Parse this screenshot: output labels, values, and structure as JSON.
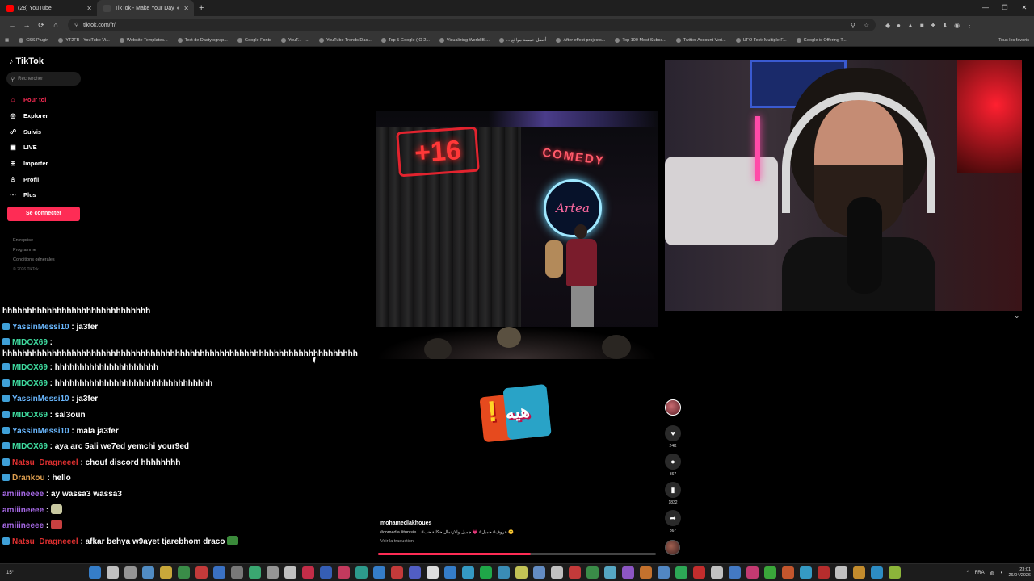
{
  "browser": {
    "tabs": [
      {
        "label": "(28) YouTube",
        "color": "#ff0000"
      },
      {
        "label": "TikTok - Make Your Day",
        "color": "#111111"
      }
    ],
    "url": "tiktok.com/fr/",
    "bookmarks": [
      "CSS Plugin",
      "YT2FB - YouTube Vi...",
      "Website Templates...",
      "Test de Dactylograp...",
      "Google Fonts",
      "YouT... - ...",
      "YouTube Trends Das...",
      "Top 5 Google (IO 2...",
      "Visualizing World Bi...",
      "... أفضل خمسة مواقع",
      "After effect projects...",
      "Top 100 Most Subsc...",
      "Twitter Account Veri...",
      "UFO Test: Multiple F...",
      "Google is Offering T..."
    ],
    "bookmarks_all": "Tous les favoris"
  },
  "tiktok": {
    "logo": "TikTok",
    "search_placeholder": "Rechercher",
    "nav": [
      {
        "label": "Pour toi",
        "icon": "home-icon"
      },
      {
        "label": "Explorer",
        "icon": "compass-icon"
      },
      {
        "label": "Suivis",
        "icon": "following-icon"
      },
      {
        "label": "LIVE",
        "icon": "live-icon"
      },
      {
        "label": "Importer",
        "icon": "upload-icon"
      },
      {
        "label": "Profil",
        "icon": "profile-icon"
      },
      {
        "label": "Plus",
        "icon": "more-icon"
      }
    ],
    "login": "Se connecter",
    "footer": [
      "Entreprise",
      "Programme",
      "Conditions générales"
    ],
    "copyright": "© 2026 TikTok",
    "video": {
      "sign": "+16",
      "neon_text": "COMEDY",
      "neon_name": "Artea",
      "sticker": "هيه"
    },
    "caption_user": "mohamedlakhoues",
    "caption_text": "#comedia #tunisie... #عروف# جميل# 💗 جميل والازنمال حكاية حب 😊",
    "caption_translate": "Voir la traduction",
    "progress": 0.55,
    "counts": {
      "likes": "24K",
      "comments": "367",
      "saves": "1832",
      "shares": "867"
    }
  },
  "chat": [
    {
      "user": "",
      "text": "hhhhhhhhhhhhhhhhhhhhhhhhhhhhhh",
      "color": "#ffffff",
      "badge": false
    },
    {
      "user": "YassinMessi10",
      "text": " : ja3fer",
      "color": "#6ab8ff",
      "badge": true
    },
    {
      "user": "MIDOX69",
      "text": " : hhhhhhhhhhhhhhhhhhhhhhhhhhhhhhhhhhhhhhhhhhhhhhhhhhhhhhhhhhhhhhhhhhhhhhhh",
      "color": "#3fdca0",
      "badge": true,
      "wrap": true
    },
    {
      "user": "MIDOX69",
      "text": " : hhhhhhhhhhhhhhhhhhhhh",
      "color": "#3fdca0",
      "badge": true
    },
    {
      "user": "MIDOX69",
      "text": " : hhhhhhhhhhhhhhhhhhhhhhhhhhhhhhhh",
      "color": "#3fdca0",
      "badge": true
    },
    {
      "user": "YassinMessi10",
      "text": " : ja3fer",
      "color": "#6ab8ff",
      "badge": true
    },
    {
      "user": "MIDOX69",
      "text": " : sal3oun",
      "color": "#3fdca0",
      "badge": true
    },
    {
      "user": "YassinMessi10",
      "text": " : mala ja3fer",
      "color": "#6ab8ff",
      "badge": true
    },
    {
      "user": "MIDOX69",
      "text": " : aya arc 5ali we7ed yemchi your9ed",
      "color": "#3fdca0",
      "badge": true
    },
    {
      "user": "Natsu_Dragneeel",
      "text": " : chouf discord hhhhhhhh",
      "color": "#e03030",
      "badge": true
    },
    {
      "user": "Drankou",
      "text": " : hello",
      "color": "#e0a050",
      "badge": true
    },
    {
      "user": "amiiineeee",
      "text": " : ay wassa3 wassa3",
      "color": "#a86ae8",
      "badge": false
    },
    {
      "user": "amiiineeee",
      "text": " : ",
      "color": "#a86ae8",
      "badge": false,
      "emote": "#c8c8a0"
    },
    {
      "user": "amiiineeee",
      "text": " : ",
      "color": "#a86ae8",
      "badge": false,
      "emote": "#c84040"
    },
    {
      "user": "Natsu_Dragneeel",
      "text": " : afkar behya w9ayet tjarebhom draco ",
      "color": "#e03030",
      "badge": true,
      "emote": "#3a8a3a"
    }
  ],
  "taskbar": {
    "weather": "15°",
    "lang": "FRA",
    "time": "23:01",
    "date": "26/04/2026"
  }
}
